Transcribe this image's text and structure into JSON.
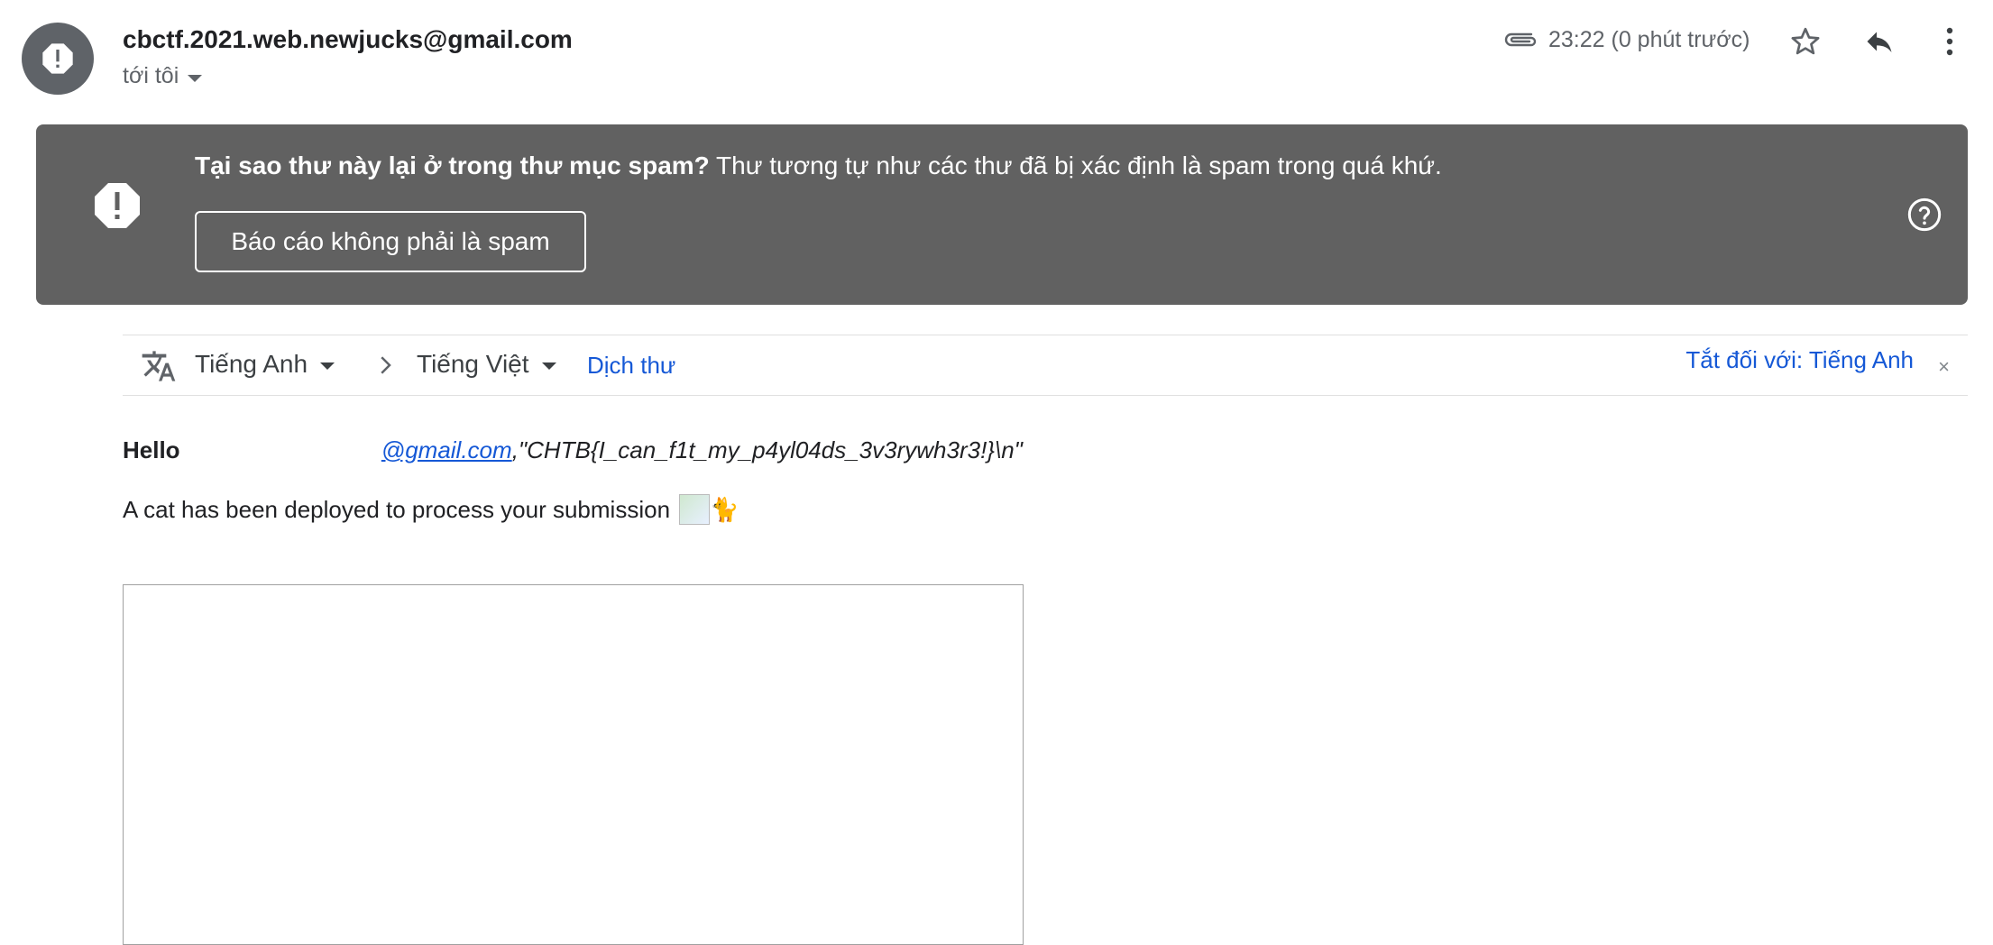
{
  "header": {
    "sender_email": "cbctf.2021.web.newjucks@gmail.com",
    "recipient_label": "tới tôi",
    "timestamp": "23:22 (0 phút trước)",
    "icons": {
      "avatar": "warning-icon",
      "attachment": "paperclip-icon",
      "star": "star-icon",
      "reply": "reply-icon",
      "more": "more-vert-icon"
    }
  },
  "spam_banner": {
    "question": "Tại sao thư này lại ở trong thư mục spam?",
    "reason": " Thư tương tự như các thư đã bị xác định là spam trong quá khứ.",
    "report_button": "Báo cáo không phải là spam",
    "icons": {
      "warning": "warning-icon",
      "help": "help-circle-icon"
    },
    "background": "#616161"
  },
  "translate_bar": {
    "source_lang": "Tiếng Anh",
    "target_lang": "Tiếng Việt",
    "translate_link": "Dịch thư",
    "turn_off_link": "Tắt đối với: Tiếng Anh",
    "close_label": "×",
    "icons": {
      "translate": "translate-icon",
      "arrow": "chevron-right-icon"
    }
  },
  "message": {
    "hello": "Hello",
    "email_link": "@gmail.com",
    "payload": ",\"CHTB{I_can_f1t_my_p4yl04ds_3v3rywh3r3!}\\n\"",
    "cat_line": "A cat has been deployed to process your submission",
    "cat_emoji": "🐈",
    "link_color": "#1558d6"
  }
}
